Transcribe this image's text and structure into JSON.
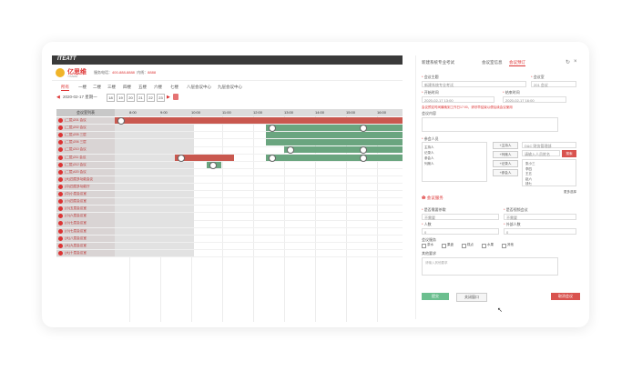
{
  "topbar": {
    "brand": "ITEATT"
  },
  "app": {
    "logo_text": "亿思维",
    "logo_sub": "YISIWEI",
    "service_label": "服务电话：",
    "service_value": "400-888-8888",
    "notice_label": "内线：",
    "notice_value": "8888"
  },
  "tabs": [
    "所有",
    "一楼",
    "二楼",
    "三楼",
    "四楼",
    "五楼",
    "六楼",
    "七楼",
    "八层会议中心",
    "九层会议中心"
  ],
  "datebar": {
    "date": "2020-02-17 星期一",
    "days": [
      "18",
      "19",
      "20",
      "21",
      "22",
      "23"
    ]
  },
  "grid": {
    "header_left": "会议室列表",
    "hours": [
      "8:00",
      "9:00",
      "10:00",
      "11:00",
      "12:00",
      "13:00",
      "14:00",
      "15:00",
      "16:00"
    ],
    "rooms": [
      "(二层)201 会议",
      "(二层)202 会议",
      "(二层)205 三层",
      "(二层)206 三层",
      "(二层)210 会议",
      "(二层)211 会议",
      "(二层)212 会议",
      "(二层)420 会议",
      "(大)四层多功能会议",
      "(中)四层多功能厅",
      "(中)小层会议室",
      "(小)四层会议室",
      "(小)五层会议室",
      "(小)六层会议室",
      "(小)七层会议室",
      "(小)七层会议室",
      "(大)八层会议室",
      "(大)九层会议室",
      "(大)十层会议室"
    ]
  },
  "panel": {
    "title": "新建系统专业考试",
    "tab1": "会议室信息",
    "tab2": "会议预订",
    "topic_label": "会议主题",
    "topic_value": "新建系统专业考试",
    "room_label": "会议室",
    "room_value": "201 会议",
    "start_label": "开始时间",
    "start_value": "2020-02-17 13:00",
    "end_label": "结束时间",
    "end_value": "2020-02-17 16:00",
    "warn": "会议预定时间最晚到工作日17:00，请尽早结束以便后续会议使用",
    "content_label": "会议内容",
    "people_label": "参会人员",
    "roles": [
      "主持人",
      "记录人",
      "参会人",
      "列席人"
    ],
    "role_btns": [
      "+主持人",
      "+列席人",
      "+记录人",
      "+参会人"
    ],
    "org_label": "D&C 财务管理部",
    "search_placeholder": "请输入人员姓名",
    "search_btn": "搜索",
    "names": [
      "张小三",
      "李四",
      "王五",
      "赵六",
      "钱七"
    ],
    "more": "更多选择",
    "service_title": "会议服务",
    "tea_label": "是否需要茶歇",
    "tea_value": "不需要",
    "video_label": "是否视频会议",
    "video_value": "不需要",
    "num_label": "人数",
    "num_value": "0",
    "ext_label": "外部人数",
    "ext_value": "0",
    "svc_label": "会议服务",
    "svc_items": [
      "茶水",
      "果盘",
      "糕点",
      "水果",
      "其他"
    ],
    "notes_label": "其他要求",
    "notes_placeholder": "请输入其他要求",
    "submit": "提交",
    "cancel": "关闭窗口",
    "delete": "取消会议"
  }
}
